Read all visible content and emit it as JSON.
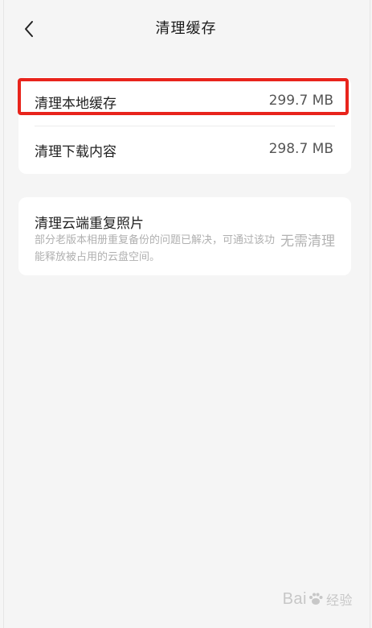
{
  "header": {
    "title": "清理缓存",
    "back_icon": "chevron-left-icon"
  },
  "cache_card": {
    "items": [
      {
        "label": "清理本地缓存",
        "value": "299.7 MB"
      },
      {
        "label": "清理下载内容",
        "value": "298.7 MB"
      }
    ]
  },
  "cloud_card": {
    "title": "清理云端重复照片",
    "description": "部分老版本相册重复备份的问题已解决，可通过该功能释放被占用的云盘空间。",
    "status": "无需清理"
  },
  "watermark": {
    "brand": "Bai",
    "suffix": "经验"
  },
  "colors": {
    "background": "#f5f5f5",
    "card": "#ffffff",
    "highlight": "#e8241c",
    "muted_text": "#b0b0b0"
  }
}
